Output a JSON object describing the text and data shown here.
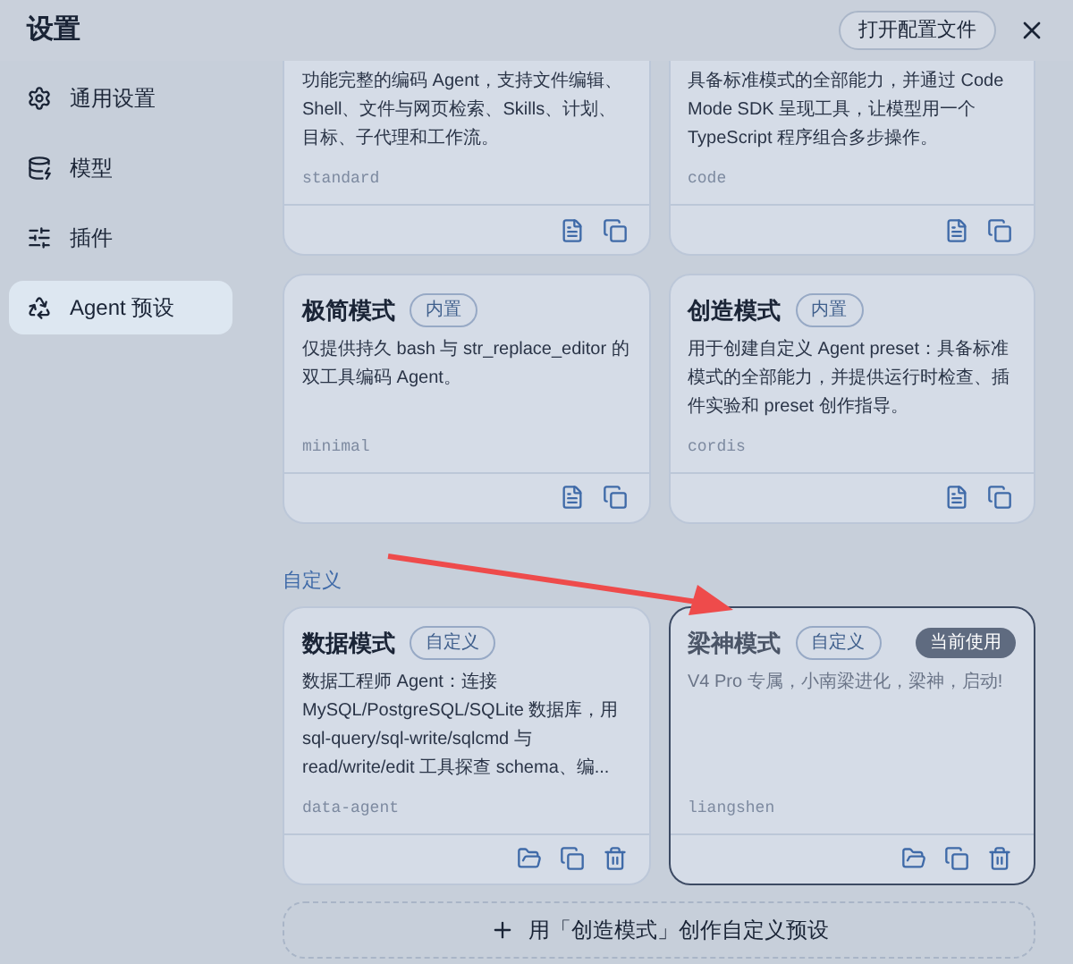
{
  "window": {
    "title": "设置",
    "open_config_button": "打开配置文件"
  },
  "sidebar": {
    "items": [
      {
        "label": "通用设置",
        "selected": false
      },
      {
        "label": "模型",
        "selected": false
      },
      {
        "label": "插件",
        "selected": false
      },
      {
        "label": "Agent 预设",
        "selected": true
      }
    ]
  },
  "builtin_presets": [
    {
      "kind": "builtin",
      "description": "功能完整的编码 Agent，支持文件编辑、Shell、文件与网页检索、Skills、计划、目标、子代理和工作流。",
      "id": "standard",
      "current": false
    },
    {
      "kind": "builtin",
      "description": "具备标准模式的全部能力，并通过 Code Mode SDK 呈现工具，让模型用一个 TypeScript 程序组合多步操作。",
      "id": "code",
      "current": false
    },
    {
      "kind": "builtin",
      "title": "极简模式",
      "badge": "内置",
      "description": "仅提供持久 bash 与 str_replace_editor 的双工具编码 Agent。",
      "id": "minimal",
      "current": false
    },
    {
      "kind": "builtin",
      "title": "创造模式",
      "badge": "内置",
      "description": "用于创建自定义 Agent preset：具备标准模式的全部能力，并提供运行时检查、插件实验和 preset 创作指导。",
      "id": "cordis",
      "current": false
    }
  ],
  "custom_section": {
    "label": "自定义",
    "presets": [
      {
        "kind": "custom",
        "title": "数据模式",
        "badge": "自定义",
        "description": "数据工程师 Agent：连接 MySQL/PostgreSQL/SQLite 数据库，用 sql-query/sql-write/sqlcmd 与 read/write/edit 工具探查 schema、编...",
        "id": "data-agent",
        "current": false
      },
      {
        "kind": "custom",
        "title": "梁神模式",
        "badge": "自定义",
        "status_badge": "当前使用",
        "description": "V4 Pro 专属，小南梁进化，梁神，启动!",
        "id": "liangshen",
        "current": true
      }
    ]
  },
  "add_button": "用「创造模式」创作自定义预设"
}
